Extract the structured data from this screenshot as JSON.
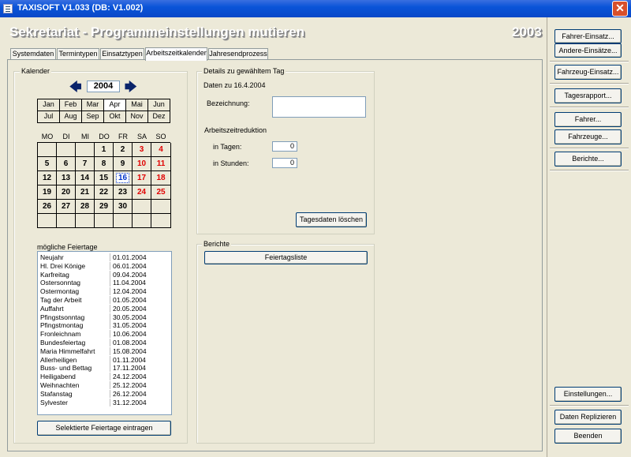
{
  "window": {
    "title": "TAXISOFT V1.033 (DB: V1.002)"
  },
  "header": {
    "heading": "Sekretariat - Programmeinstellungen mutieren",
    "year": "2003"
  },
  "tabs": [
    {
      "label": "Systemdaten"
    },
    {
      "label": "Termintypen"
    },
    {
      "label": "Einsatztypen"
    },
    {
      "label": "Arbeitszeitkalender"
    },
    {
      "label": "Jahresendprozess"
    }
  ],
  "kalender": {
    "group_title": "Kalender",
    "prev_arrow": "🡄",
    "next_arrow": "🡆",
    "year": "2004",
    "months_row1": [
      "Jan",
      "Feb",
      "Mar",
      "Apr",
      "Mai",
      "Jun"
    ],
    "months_row2": [
      "Jul",
      "Aug",
      "Sep",
      "Okt",
      "Nov",
      "Dez"
    ],
    "selected_month": "Apr",
    "weekdays": [
      "MO",
      "DI",
      "MI",
      "DO",
      "FR",
      "SA",
      "SO"
    ],
    "weeks": [
      [
        "",
        "",
        "",
        "1",
        "2",
        "3",
        "4"
      ],
      [
        "5",
        "6",
        "7",
        "8",
        "9",
        "10",
        "11"
      ],
      [
        "12",
        "13",
        "14",
        "15",
        "16",
        "17",
        "18"
      ],
      [
        "19",
        "20",
        "21",
        "22",
        "23",
        "24",
        "25"
      ],
      [
        "26",
        "27",
        "28",
        "29",
        "30",
        "",
        ""
      ],
      [
        "",
        "",
        "",
        "",
        "",
        "",
        ""
      ]
    ],
    "today": "16"
  },
  "feiertage": {
    "label": "mögliche Feiertage",
    "items": [
      {
        "name": "Neujahr",
        "date": "01.01.2004"
      },
      {
        "name": "Hl. Drei Könige",
        "date": "06.01.2004"
      },
      {
        "name": "Karfreitag",
        "date": "09.04.2004"
      },
      {
        "name": "Ostersonntag",
        "date": "11.04.2004"
      },
      {
        "name": "Ostermontag",
        "date": "12.04.2004"
      },
      {
        "name": "Tag der Arbeit",
        "date": "01.05.2004"
      },
      {
        "name": "Auffahrt",
        "date": "20.05.2004"
      },
      {
        "name": "Pfingstsonntag",
        "date": "30.05.2004"
      },
      {
        "name": "Pfingstmontag",
        "date": "31.05.2004"
      },
      {
        "name": "Fronleichnam",
        "date": "10.06.2004"
      },
      {
        "name": "Bundesfeiertag",
        "date": "01.08.2004"
      },
      {
        "name": "Maria Himmelfahrt",
        "date": "15.08.2004"
      },
      {
        "name": "Allerheiligen",
        "date": "01.11.2004"
      },
      {
        "name": "Buss- und Bettag",
        "date": "17.11.2004"
      },
      {
        "name": "Heiligabend",
        "date": "24.12.2004"
      },
      {
        "name": "Weihnachten",
        "date": "25.12.2004"
      },
      {
        "name": "Stafanstag",
        "date": "26.12.2004"
      },
      {
        "name": "Sylvester",
        "date": "31.12.2004"
      }
    ],
    "button": "Selektierte Feiertage eintragen"
  },
  "details": {
    "group_title": "Details zu gewähltem Tag",
    "date_label": "Daten zu 16.4.2004",
    "bezeichnung_label": "Bezeichnung:",
    "bezeichnung_value": "",
    "reduktion_label": "Arbeitszeitreduktion",
    "tage_label": "in Tagen:",
    "tage_value": "0",
    "stunden_label": "in Stunden:",
    "stunden_value": "0",
    "delete_button": "Tagesdaten löschen"
  },
  "berichte": {
    "group_title": "Berichte",
    "button": "Feiertagsliste"
  },
  "sidebar": {
    "buttons_top": [
      "Fahrer-Einsatz...",
      "Andere-Einsätze..."
    ],
    "fahrzeug_einsatz": "Fahrzeug-Einsatz...",
    "tagesrapport": "Tagesrapport...",
    "fahrer": "Fahrer...",
    "fahrzeuge": "Fahrzeuge...",
    "berichte": "Berichte...",
    "einstellungen": "Einstellungen...",
    "daten_replizieren": "Daten Replizieren",
    "beenden": "Beenden"
  }
}
